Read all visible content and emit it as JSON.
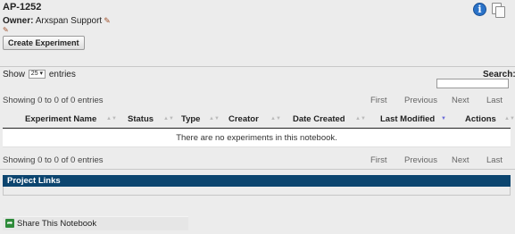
{
  "notebook": {
    "title": "AP-1252",
    "owner_label": "Owner:",
    "owner_name": "Arxspan Support"
  },
  "actions": {
    "create_label": "Create Experiment"
  },
  "table_controls": {
    "show_label": "Show",
    "length_value": "25",
    "entries_label": "entries",
    "search_label": "Search:",
    "search_value": ""
  },
  "info": {
    "text_top": "Showing 0 to 0 of 0 entries",
    "text_bottom": "Showing 0 to 0 of 0 entries"
  },
  "pager": {
    "first": "First",
    "previous": "Previous",
    "next": "Next",
    "last": "Last"
  },
  "table": {
    "columns": [
      "Experiment Name",
      "Status",
      "Type",
      "Creator",
      "Date Created",
      "Last Modified",
      "Actions"
    ],
    "empty_message": "There are no experiments in this notebook."
  },
  "project_links": {
    "header": "Project Links"
  },
  "share": {
    "label": "Share This Notebook"
  },
  "icons": {
    "info": "info-icon",
    "copy": "copy-icon",
    "edit": "pencil-icon",
    "share": "share-icon",
    "sort": "sort-icon"
  },
  "colors": {
    "project_links_bg": "#0c456f",
    "info_icon": "#2a72c8",
    "share_icon": "#2e8b3a"
  }
}
